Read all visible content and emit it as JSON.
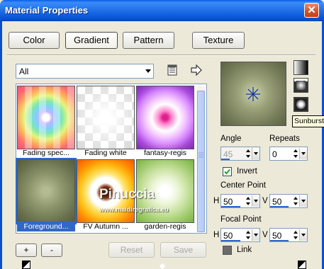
{
  "window": {
    "title": "Material Properties"
  },
  "tabs": [
    {
      "label": "Color",
      "active": false
    },
    {
      "label": "Gradient",
      "active": true
    },
    {
      "label": "Pattern",
      "active": false
    },
    {
      "label": "Texture",
      "active": false
    }
  ],
  "category": {
    "selected": "All"
  },
  "gradients": [
    {
      "name": "Fading spec...",
      "selected": false
    },
    {
      "name": "Fading white",
      "selected": false
    },
    {
      "name": "fantasy-regis",
      "selected": false
    },
    {
      "name": "Foreground...",
      "selected": true
    },
    {
      "name": "FV Autumn ...",
      "selected": false
    },
    {
      "name": "garden-regis",
      "selected": false
    }
  ],
  "buttons": {
    "add": "+",
    "remove": "-",
    "reset": "Reset",
    "save": "Save"
  },
  "style_tooltip": "Sunburst",
  "angle": {
    "label": "Angle",
    "value": "45"
  },
  "repeats": {
    "label": "Repeats",
    "value": "0"
  },
  "invert": {
    "label": "Invert",
    "checked": true
  },
  "center_point": {
    "label": "Center Point",
    "h_label": "H",
    "h": "50",
    "v_label": "V",
    "v": "50"
  },
  "focal_point": {
    "label": "Focal Point",
    "h_label": "H",
    "h": "50",
    "v_label": "V",
    "v": "50"
  },
  "link": {
    "label": "Link",
    "checked": false
  },
  "watermark": {
    "name": "Pinuccia",
    "site": "www.maidiregrafica.eu"
  },
  "colors": {
    "selection": "#3168c6",
    "titlebar": "#0a5ee6",
    "close": "#d2502a"
  }
}
